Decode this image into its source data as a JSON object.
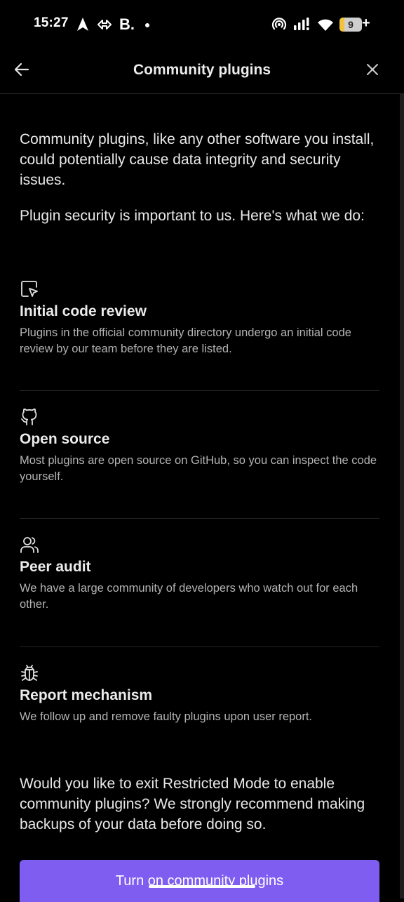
{
  "status_bar": {
    "time": "15:27",
    "app_letter": "B.",
    "battery_level": "9",
    "battery_plus": "+",
    "icons": [
      "navigation-arrow-icon",
      "data-transfer-icon",
      "hotspot-icon",
      "signal-icon",
      "wifi-icon",
      "battery-icon"
    ]
  },
  "header": {
    "title": "Community plugins",
    "back_icon": "arrow-left-icon",
    "close_icon": "close-icon"
  },
  "intro": {
    "paragraph1": "Community plugins, like any other software you install, could potentially cause data integrity and security issues.",
    "paragraph2": "Plugin security is important to us. Here's what we do:"
  },
  "features": [
    {
      "icon": "code-review-icon",
      "title": "Initial code review",
      "description": "Plugins in the official community directory undergo an initial code review by our team before they are listed."
    },
    {
      "icon": "github-icon",
      "title": "Open source",
      "description": "Most plugins are open source on GitHub, so you can inspect the code yourself."
    },
    {
      "icon": "users-icon",
      "title": "Peer audit",
      "description": "We have a large community of developers who watch out for each other."
    },
    {
      "icon": "bug-icon",
      "title": "Report mechanism",
      "description": "We follow up and remove faulty plugins upon user report."
    }
  ],
  "outro": {
    "paragraph": "Would you like to exit Restricted Mode to enable community plugins? We strongly recommend making backups of your data before doing so."
  },
  "cta": {
    "label": "Turn on community plugins"
  },
  "colors": {
    "background": "#000000",
    "accent": "#7f5df0",
    "text_primary": "#e8e8e8",
    "text_secondary": "#b3b3b3"
  }
}
